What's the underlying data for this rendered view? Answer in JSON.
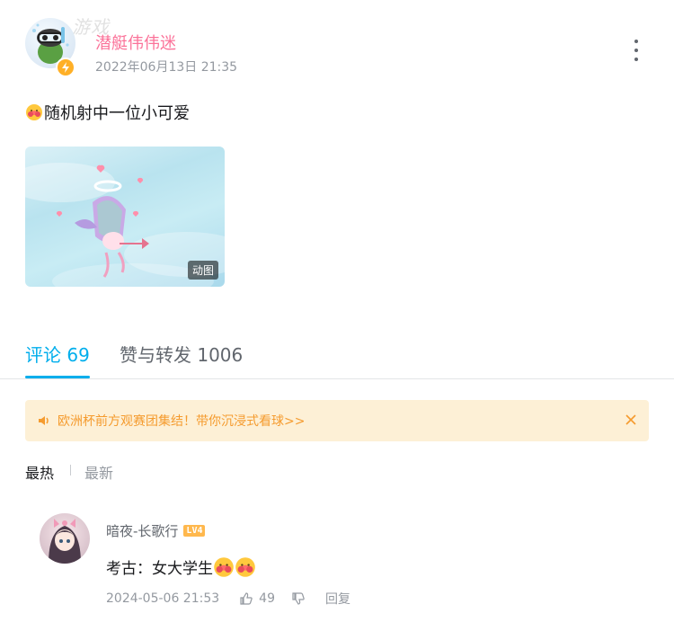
{
  "watermark": "游戏",
  "author": {
    "name": "潜艇伟伟迷",
    "time": "2022年06月13日 21:35"
  },
  "post": {
    "text": "随机射中一位小可爱",
    "image_badge": "动图"
  },
  "tabs": {
    "comments": "评论 69",
    "shares": "赞与转发 1006"
  },
  "notice": {
    "text": "欧洲杯前方观赛团集结！带你沉浸式看球>>"
  },
  "sort": {
    "hot": "最热",
    "new": "最新"
  },
  "reply": {
    "user": "暗夜-长歌行",
    "level": "LV4",
    "text": "考古：女大学生",
    "time": "2024-05-06 21:53",
    "likes": "49",
    "reply_label": "回复"
  },
  "colors": {
    "accent": "#00aeec",
    "username_pink": "#fb7299",
    "notice_bg": "#fdf0d6",
    "notice_text": "#f59b2e"
  },
  "icons": [
    "more-icon",
    "lightning-icon",
    "emoji-icon",
    "speaker-icon",
    "close-icon",
    "thumb-up-icon",
    "thumb-down-icon"
  ]
}
